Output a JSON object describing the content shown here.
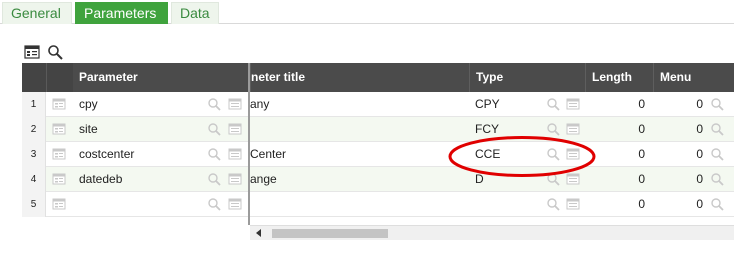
{
  "tabs": [
    {
      "label": "General"
    },
    {
      "label": "Parameters"
    },
    {
      "label": "Data"
    }
  ],
  "colors": {
    "accent": "#3fa33d",
    "header": "#4b4b4b",
    "highlight": "#e00000"
  },
  "columns": {
    "parameter": "Parameter",
    "title": "neter title",
    "type": "Type",
    "length": "Length",
    "menu": "Menu"
  },
  "rows": [
    {
      "num": "1",
      "parameter": "cpy",
      "title": "any",
      "type": "CPY",
      "length": "0",
      "menu": "0"
    },
    {
      "num": "2",
      "parameter": "site",
      "title": "",
      "type": "FCY",
      "length": "0",
      "menu": "0"
    },
    {
      "num": "3",
      "parameter": "costcenter",
      "title": "Center",
      "type": "CCE",
      "length": "0",
      "menu": "0"
    },
    {
      "num": "4",
      "parameter": "datedeb",
      "title": "ange",
      "type": "D",
      "length": "0",
      "menu": "0"
    },
    {
      "num": "5",
      "parameter": "",
      "title": "",
      "type": "",
      "length": "0",
      "menu": "0"
    }
  ]
}
